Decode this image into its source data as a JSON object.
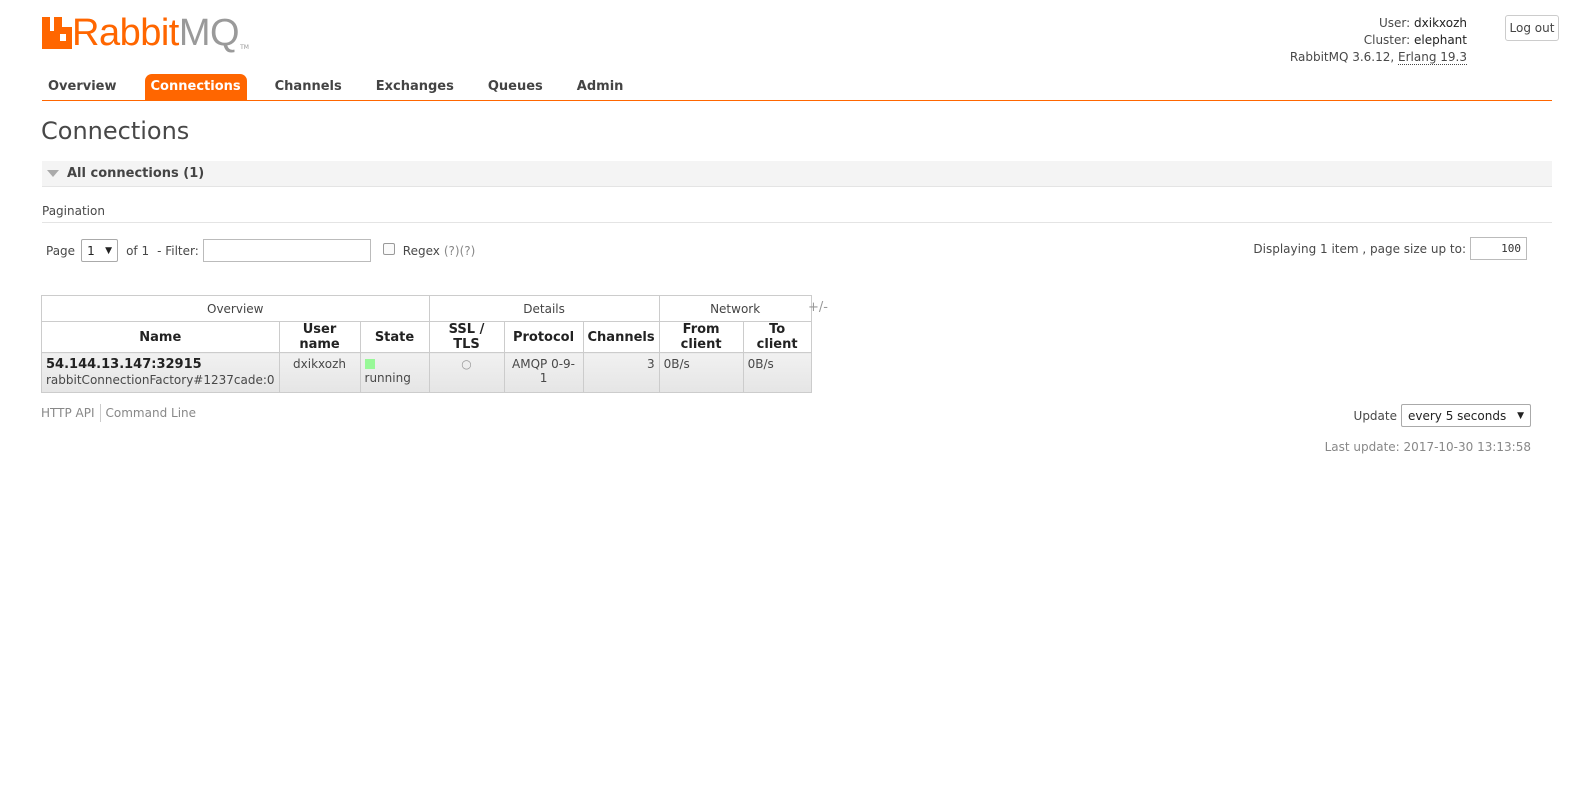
{
  "logo": {
    "part1": "Rabbit",
    "part2": "MQ",
    "tm": "TM",
    "brand_color": "#ff6600"
  },
  "login": {
    "user_label": "User:",
    "user": "dxikxozh",
    "cluster_label": "Cluster:",
    "cluster": "elephant",
    "version": "RabbitMQ 3.6.12,",
    "erlang": "Erlang 19.3",
    "logout_label": "Log out"
  },
  "tabs": [
    {
      "label": "Overview",
      "selected": false
    },
    {
      "label": "Connections",
      "selected": true
    },
    {
      "label": "Channels",
      "selected": false
    },
    {
      "label": "Exchanges",
      "selected": false
    },
    {
      "label": "Queues",
      "selected": false
    },
    {
      "label": "Admin",
      "selected": false
    }
  ],
  "page_title": "Connections",
  "section": {
    "label": "All connections (1)"
  },
  "pagination": {
    "title": "Pagination",
    "page_label": "Page",
    "page_value": "1",
    "of_label": "of 1",
    "filter_label": "- Filter:",
    "filter_value": "",
    "regex_label": "Regex",
    "help1": "(?)",
    "help2": "(?)",
    "display_label": "Displaying 1 item , page size up to:",
    "page_size": "100"
  },
  "table": {
    "groups": [
      "Overview",
      "Details",
      "Network"
    ],
    "columns": [
      "Name",
      "User name",
      "State",
      "SSL / TLS",
      "Protocol",
      "Channels",
      "From client",
      "To client"
    ],
    "toggle": "+/-",
    "rows": [
      {
        "name": "54.144.13.147:32915",
        "sub": "rabbitConnectionFactory#1237cade:0",
        "user": "dxikxozh",
        "state": "running",
        "ssl": "○",
        "protocol": "AMQP 0-9-1",
        "channels": "3",
        "from_client": "0B/s",
        "to_client": "0B/s"
      }
    ]
  },
  "footer": {
    "http_api": "HTTP API",
    "command_line": "Command Line",
    "update_label": "Update",
    "update_value": "every 5 seconds",
    "last_update": "Last update: 2017-10-30 13:13:58"
  },
  "colors": {
    "accent": "#ff6600",
    "running": "#98f898"
  }
}
